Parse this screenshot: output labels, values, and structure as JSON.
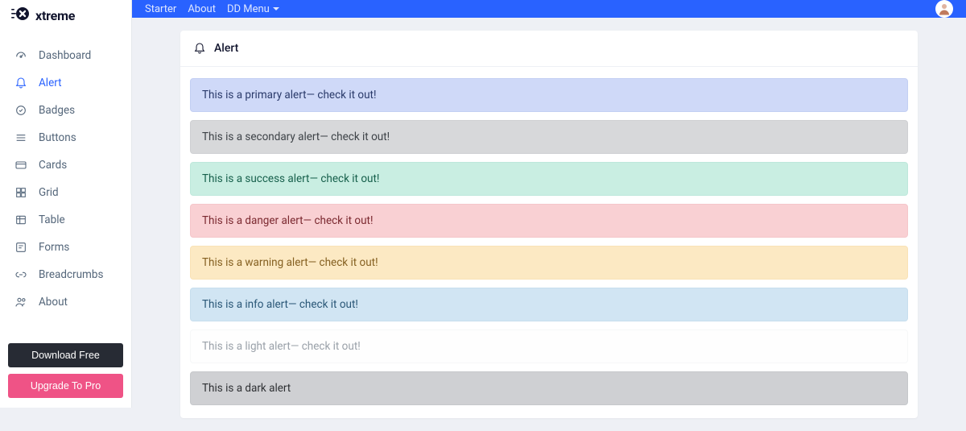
{
  "brand": {
    "name": "xtreme"
  },
  "sidebar": {
    "items": [
      {
        "label": "Dashboard"
      },
      {
        "label": "Alert"
      },
      {
        "label": "Badges"
      },
      {
        "label": "Buttons"
      },
      {
        "label": "Cards"
      },
      {
        "label": "Grid"
      },
      {
        "label": "Table"
      },
      {
        "label": "Forms"
      },
      {
        "label": "Breadcrumbs"
      },
      {
        "label": "About"
      }
    ],
    "download_label": "Download Free",
    "upgrade_label": "Upgrade To Pro"
  },
  "topnav": {
    "starter": "Starter",
    "about": "About",
    "ddmenu": "DD Menu"
  },
  "card": {
    "title": "Alert"
  },
  "alerts": {
    "primary": "This is a primary alert— check it out!",
    "secondary": "This is a secondary alert— check it out!",
    "success": "This is a success alert— check it out!",
    "danger": "This is a danger alert— check it out!",
    "warning": "This is a warning alert— check it out!",
    "info": "This is a info alert— check it out!",
    "light": "This is a light alert— check it out!",
    "dark": "This is a dark alert"
  }
}
